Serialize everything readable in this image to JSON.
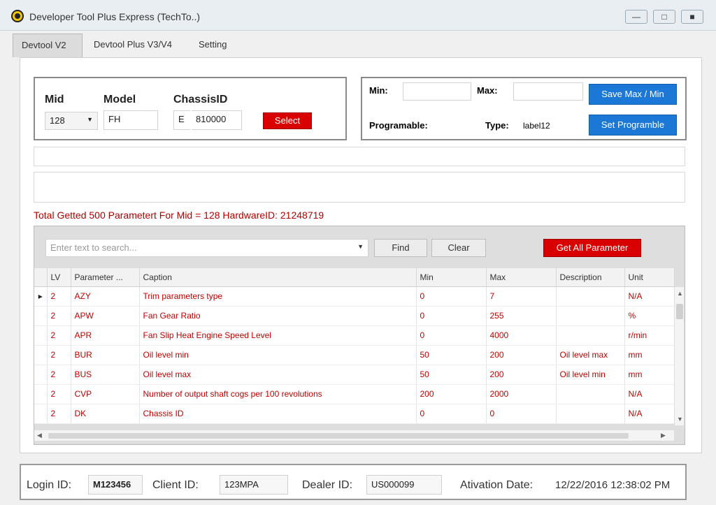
{
  "window": {
    "title": "Developer Tool Plus Express (TechTo..)",
    "controls": [
      "minimize",
      "maximize",
      "close"
    ]
  },
  "tabs": [
    {
      "label": "Devtool V2",
      "active": true
    },
    {
      "label": "Devtool Plus V3/V4",
      "active": false
    },
    {
      "label": "Setting",
      "active": false
    }
  ],
  "selector": {
    "mid_label": "Mid",
    "model_label": "Model",
    "chassis_label": "ChassisID",
    "mid_value": "128",
    "model_value": "FH",
    "chassis_prefix": "E",
    "chassis_value": "810000",
    "select_button": "Select"
  },
  "limits": {
    "min_label": "Min:",
    "max_label": "Max:",
    "min_value": "",
    "max_value": "",
    "save_button": "Save Max / Min",
    "programable_label": "Programable:",
    "type_label": "Type:",
    "type_value": "label12",
    "set_programable_button": "Set Programble"
  },
  "status": {
    "total_text": "Total Getted 500 Parametert For  Mid = 128 HardwareID:  21248719"
  },
  "search": {
    "placeholder": "Enter text to search...",
    "find_button": "Find",
    "clear_button": "Clear",
    "get_all_button": "Get All Parameter"
  },
  "grid": {
    "columns": [
      "LV",
      "Parameter ...",
      "Caption",
      "Min",
      "Max",
      "Description",
      "Unit"
    ],
    "rows": [
      {
        "lv": "2",
        "param": "AZY",
        "caption": "Trim parameters type",
        "min": "0",
        "max": "7",
        "desc": "",
        "unit": "N/A",
        "current": true
      },
      {
        "lv": "2",
        "param": "APW",
        "caption": "Fan Gear Ratio",
        "min": "0",
        "max": "255",
        "desc": "",
        "unit": "%",
        "current": false
      },
      {
        "lv": "2",
        "param": "APR",
        "caption": "Fan Slip Heat Engine Speed Level",
        "min": "0",
        "max": "4000",
        "desc": "",
        "unit": "r/min",
        "current": false
      },
      {
        "lv": "2",
        "param": "BUR",
        "caption": "Oil level min",
        "min": "50",
        "max": "200",
        "desc": "Oil level max",
        "unit": "mm",
        "current": false
      },
      {
        "lv": "2",
        "param": "BUS",
        "caption": "Oil level max",
        "min": "50",
        "max": "200",
        "desc": "Oil level min",
        "unit": "mm",
        "current": false
      },
      {
        "lv": "2",
        "param": "CVP",
        "caption": "Number of output shaft cogs per 100 revolutions",
        "min": "200",
        "max": "2000",
        "desc": "",
        "unit": "N/A",
        "current": false
      },
      {
        "lv": "2",
        "param": "DK",
        "caption": "Chassis ID",
        "min": "0",
        "max": "0",
        "desc": "",
        "unit": "N/A",
        "current": false
      }
    ]
  },
  "footer": {
    "login_label": "Login ID:",
    "login_value": "M123456",
    "client_label": "Client ID:",
    "client_value": "123MPA",
    "dealer_label": "Dealer ID:",
    "dealer_value": "US000099",
    "activation_label": "Ativation Date:",
    "activation_value": "12/22/2016 12:38:02 PM"
  },
  "colors": {
    "accent_red": "#d80000",
    "accent_blue": "#1b78d6",
    "grid_text": "#c00000"
  }
}
